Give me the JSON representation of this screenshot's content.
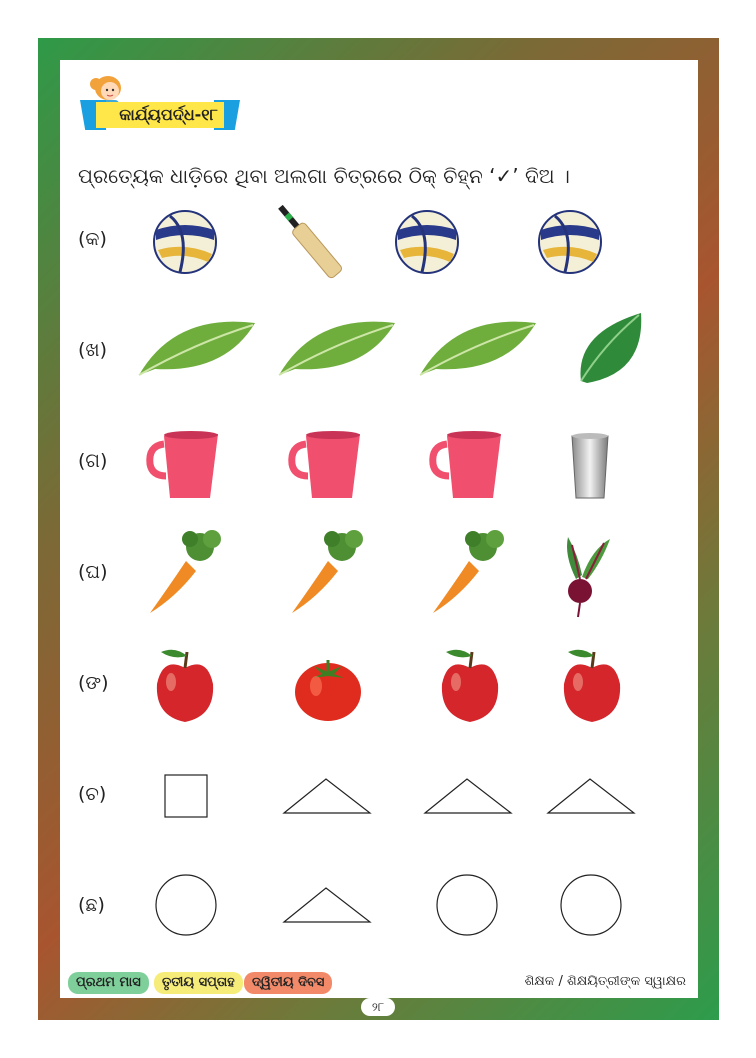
{
  "worksheet": {
    "title": "କାର୍ଯ୍ୟପର୍ଦ୍ଧ-୧୮",
    "instruction": "ପ୍ରତ୍ୟେକ ଧାଡ଼ିରେ ଥିବା ଅଲଗା ଚିତ୍ରରେ ଠିକ୍ ଚିହ୍ନ ‘✓’ ଦିଅ ।"
  },
  "rows": [
    {
      "label": "(କ)",
      "items": [
        "volleyball-icon",
        "cricket-bat-icon",
        "volleyball-icon",
        "volleyball-icon"
      ]
    },
    {
      "label": "(ଖ)",
      "items": [
        "leaf-icon",
        "leaf-icon",
        "leaf-icon",
        "dark-leaf-icon"
      ]
    },
    {
      "label": "(ଗ)",
      "items": [
        "jug-icon",
        "jug-icon",
        "jug-icon",
        "steel-glass-icon"
      ]
    },
    {
      "label": "(ଘ)",
      "items": [
        "carrot-icon",
        "carrot-icon",
        "carrot-icon",
        "beetroot-icon"
      ]
    },
    {
      "label": "(ଙ)",
      "items": [
        "apple-icon",
        "tomato-icon",
        "apple-icon",
        "apple-icon"
      ]
    },
    {
      "label": "(ଚ)",
      "items": [
        "square-shape",
        "triangle-shape",
        "triangle-shape",
        "triangle-shape"
      ]
    },
    {
      "label": "(ଛ)",
      "items": [
        "circle-shape",
        "triangle-shape",
        "circle-shape",
        "circle-shape"
      ]
    }
  ],
  "footer": {
    "month": "ପ୍ରଥମ ମାସ",
    "week": "ତୃତୀୟ ସପ୍ତାହ",
    "day": "ଦ୍ୱିତୀୟ ଦିବସ",
    "signature": "ଶିକ୍ଷକ / ଶିକ୍ଷୟିତ୍ରୀଙ୍କ ସ୍ୱାକ୍ଷର",
    "page": "୨୮",
    "colors": {
      "month": "#7fcf9a",
      "week": "#f6ec7a",
      "day": "#f28a6a"
    }
  }
}
